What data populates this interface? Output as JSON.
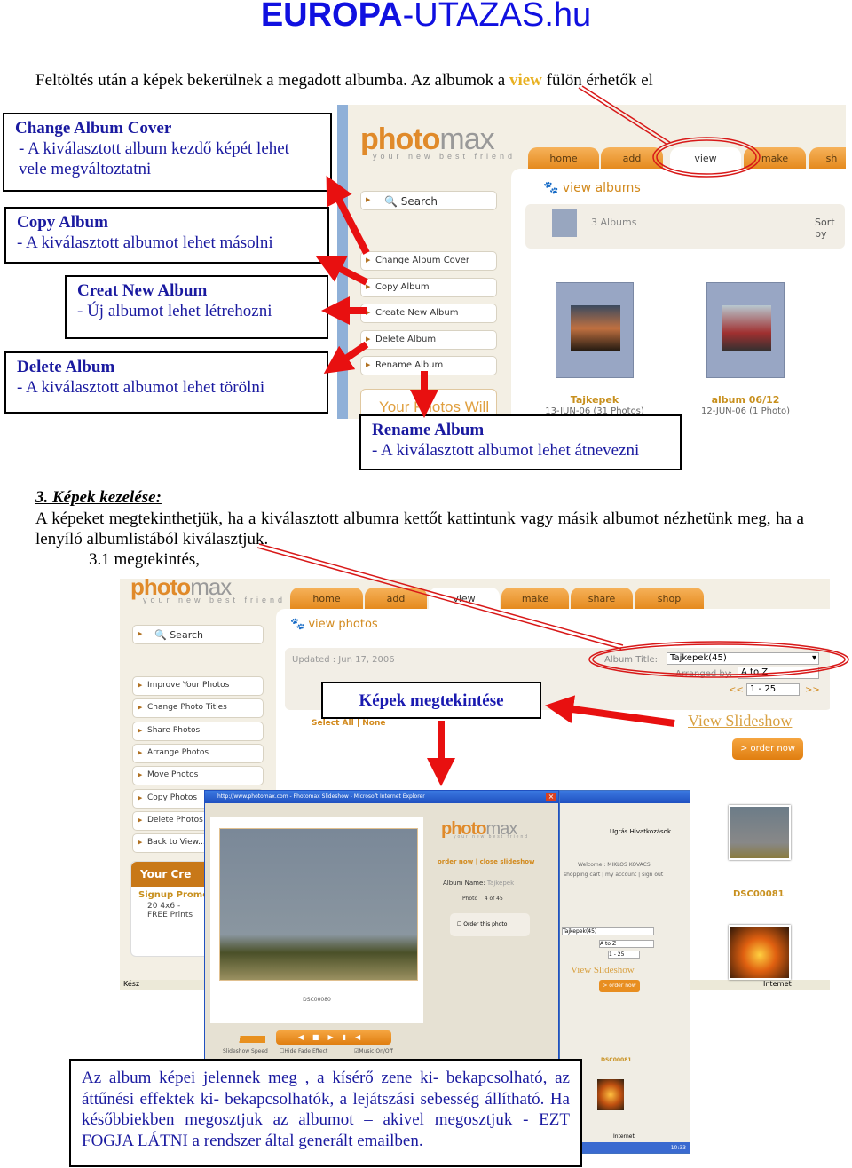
{
  "title": {
    "bold": "EUROPA",
    "rest": "-UTAZAS.hu"
  },
  "intro": {
    "before": "Feltöltés után a képek bekerülnek a megadott albumba. Az albumok a ",
    "highlight": "view",
    "after": " fülön érhetők el"
  },
  "callouts": [
    {
      "heading": "Change Album Cover",
      "text": "- A kiválasztott album kezdő képét lehet vele megváltoztatni"
    },
    {
      "heading": "Copy Album",
      "text": "- A kiválasztott albumot lehet másolni"
    },
    {
      "heading": "Creat New Album",
      "text": "- Új albumot lehet létrehozni"
    },
    {
      "heading": "Delete Album",
      "text": "- A kiválasztott albumot lehet törölni"
    },
    {
      "heading": "Rename Album",
      "text": "- A kiválasztott albumot lehet átnevezni"
    }
  ],
  "shot1": {
    "logo": "photo",
    "logo2": "max",
    "tagline": "your new best friend",
    "tabs": [
      "home",
      "add",
      "view",
      "make",
      "sh"
    ],
    "active_tab": "view",
    "search": "Search",
    "section": "view albums",
    "album_count": "3 Albums",
    "sort": "Sort by",
    "menu": [
      "Change Album Cover",
      "Copy Album",
      "Create New Album",
      "Delete Album",
      "Rename Album"
    ],
    "promo": "Your Photos Will",
    "albums": [
      {
        "name": "Tajkepek",
        "meta": "13-JUN-06 (31 Photos)"
      },
      {
        "name": "album 06/12",
        "meta": "12-JUN-06 (1 Photo)"
      }
    ]
  },
  "section3": {
    "heading": "3. Képek kezelése:",
    "body": "A képeket megtekinthetjük, ha a kiválasztott albumra kettőt kattintunk vagy másik albumot nézhetünk meg, ha a lenyíló albumlistából kiválasztjuk.",
    "sub": "3.1 megtekintés,"
  },
  "shot2": {
    "tabs": [
      "home",
      "add",
      "view",
      "make",
      "share",
      "shop"
    ],
    "search": "Search",
    "section": "view photos",
    "updated": "Updated : Jun 17, 2006",
    "album_title_label": "Album Title:",
    "album_title_value": "Tajkepek(45)",
    "arranged_label": "Arranged by:",
    "arranged_value": "A to Z",
    "page_range": "1 - 25",
    "prev": "<<",
    "next": ">>",
    "select_all": "Select All",
    "none": "None",
    "view_slideshow": "View Slideshow",
    "order_now": "> order now",
    "menu": [
      "Improve Your Photos",
      "Change Photo Titles",
      "Share Photos",
      "Arrange Photos",
      "Move Photos",
      "Copy Photos",
      "Delete Photos",
      "Back to View..."
    ],
    "promo_title": "Your Cre",
    "promo_sub": "Signup Promo",
    "promo_item": "20 4x6 - FREE Prints",
    "status": "Kész",
    "status_zone": "Internet",
    "thumbs": [
      "DSC00081"
    ]
  },
  "callout_view": "Képek megtekintése",
  "slideshow": {
    "window_title": "http://www.photomax.com - Photomax Slideshow - Microsoft Internet Explorer",
    "order_now": "order now",
    "close": "close slideshow",
    "album_name_label": "Album Name:",
    "album_name": "Tajkepek",
    "photo_label": "Photo",
    "photo_index": "4 of 45",
    "order_photo": "Order this photo",
    "caption": "DSC00080",
    "speed_label": "Slideshow Speed",
    "hide_fade": "Hide Fade Effect",
    "music": "Music On/Off"
  },
  "bg_window": {
    "go": "Ugrás",
    "links": "Hivatkozások",
    "welcome": "Welcome : MIKLOS KOVACS",
    "links_row": "shopping cart | my account | sign out",
    "album": "Tajkepek(45)",
    "arranged": "A to Z",
    "range": "1 - 25",
    "view_slideshow": "View Slideshow",
    "order_now": "> order now",
    "thumb": "DSC00081",
    "zone": "Internet",
    "clock": "10:33"
  },
  "bottom_note": "Az album képei jelennek meg , a kísérő zene ki- bekapcsolható, az áttűnési effektek ki- bekapcsolhatók, a lejátszási sebesség állítható. Ha későbbiekben megosztjuk az albumot – akivel megosztjuk - EZT FOGJA LÁTNI a rendszer által generált emailben.",
  "colors": {
    "title": "#1010e0",
    "callout_text": "#1a1aa0",
    "arrow": "#e81010",
    "tab": "#e8901e",
    "highlight": "#e8b020"
  }
}
